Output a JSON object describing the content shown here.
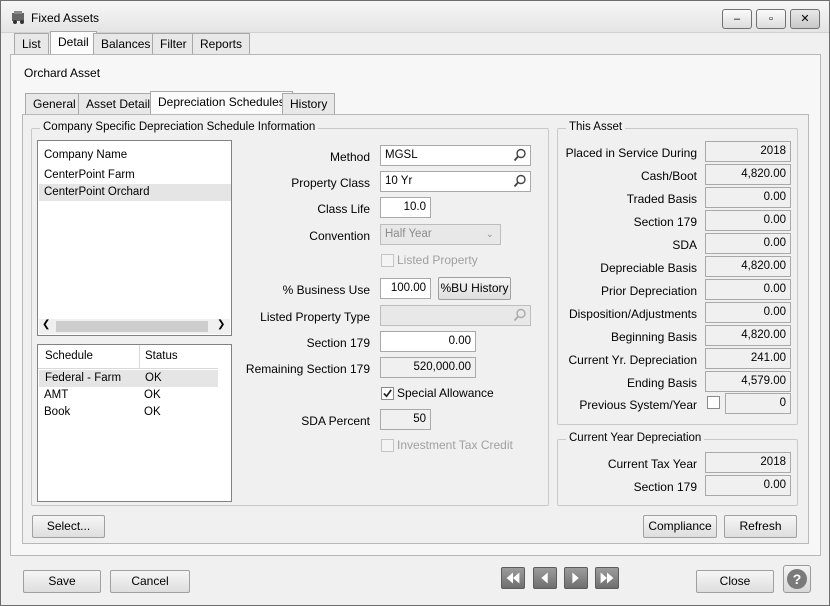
{
  "window": {
    "title": "Fixed Assets",
    "minimize": "–",
    "maximize": "▫",
    "close": "✕"
  },
  "main_tabs": [
    "List",
    "Detail",
    "Balances",
    "Filter",
    "Reports"
  ],
  "asset_name": "Orchard Asset",
  "sub_tabs": [
    "General",
    "Asset Detail",
    "Depreciation Schedules",
    "History"
  ],
  "company_group": {
    "title": "Company Specific Depreciation Schedule Information",
    "company_header": "Company Name",
    "companies": [
      "CenterPoint Farm",
      "CenterPoint Orchard"
    ],
    "schedule_headers": [
      "Schedule",
      "Status"
    ],
    "schedules": [
      {
        "name": "Federal - Farm",
        "status": "OK"
      },
      {
        "name": "AMT",
        "status": "OK"
      },
      {
        "name": "Book",
        "status": "OK"
      }
    ]
  },
  "form": {
    "method_label": "Method",
    "method_value": "MGSL",
    "property_class_label": "Property Class",
    "property_class_value": "10 Yr",
    "class_life_label": "Class Life",
    "class_life_value": "10.0",
    "convention_label": "Convention",
    "convention_value": "Half Year",
    "listed_property_label": "Listed Property",
    "business_use_label": "% Business Use",
    "business_use_value": "100.00",
    "bu_history_button": "%BU History",
    "listed_property_type_label": "Listed Property Type",
    "listed_property_type_value": "",
    "section179_label": "Section 179",
    "section179_value": "0.00",
    "remaining179_label": "Remaining Section 179",
    "remaining179_value": "520,000.00",
    "special_allowance_label": "Special Allowance",
    "sda_percent_label": "SDA Percent",
    "sda_percent_value": "50",
    "itc_label": "Investment Tax Credit"
  },
  "this_asset": {
    "title": "This Asset",
    "rows": [
      {
        "label": "Placed in Service During",
        "value": "2018"
      },
      {
        "label": "Cash/Boot",
        "value": "4,820.00"
      },
      {
        "label": "Traded Basis",
        "value": "0.00"
      },
      {
        "label": "Section 179",
        "value": "0.00"
      },
      {
        "label": "SDA",
        "value": "0.00"
      },
      {
        "label": "Depreciable Basis",
        "value": "4,820.00"
      },
      {
        "label": "Prior Depreciation",
        "value": "0.00"
      },
      {
        "label": "Disposition/Adjustments",
        "value": "0.00"
      },
      {
        "label": "Beginning Basis",
        "value": "4,820.00"
      },
      {
        "label": "Current Yr. Depreciation",
        "value": "241.00"
      },
      {
        "label": "Ending Basis",
        "value": "4,579.00"
      }
    ],
    "previous_label": "Previous System/Year",
    "previous_value": "0"
  },
  "current_year": {
    "title": "Current Year Depreciation",
    "rows": [
      {
        "label": "Current Tax Year",
        "value": "2018"
      },
      {
        "label": "Section 179",
        "value": "0.00"
      }
    ]
  },
  "buttons": {
    "select": "Select...",
    "compliance": "Compliance",
    "refresh": "Refresh",
    "save": "Save",
    "cancel": "Cancel",
    "close": "Close",
    "help": "?"
  },
  "colors": {
    "nav_button": "#7e7e7e",
    "selected_row": "#e5e5e5",
    "accent": "#2b2b2b"
  },
  "icons": [
    "fixed-assets-icon",
    "search-icon",
    "first-record-icon",
    "previous-record-icon",
    "next-record-icon",
    "last-record-icon",
    "help-icon",
    "checkmark-icon"
  ]
}
